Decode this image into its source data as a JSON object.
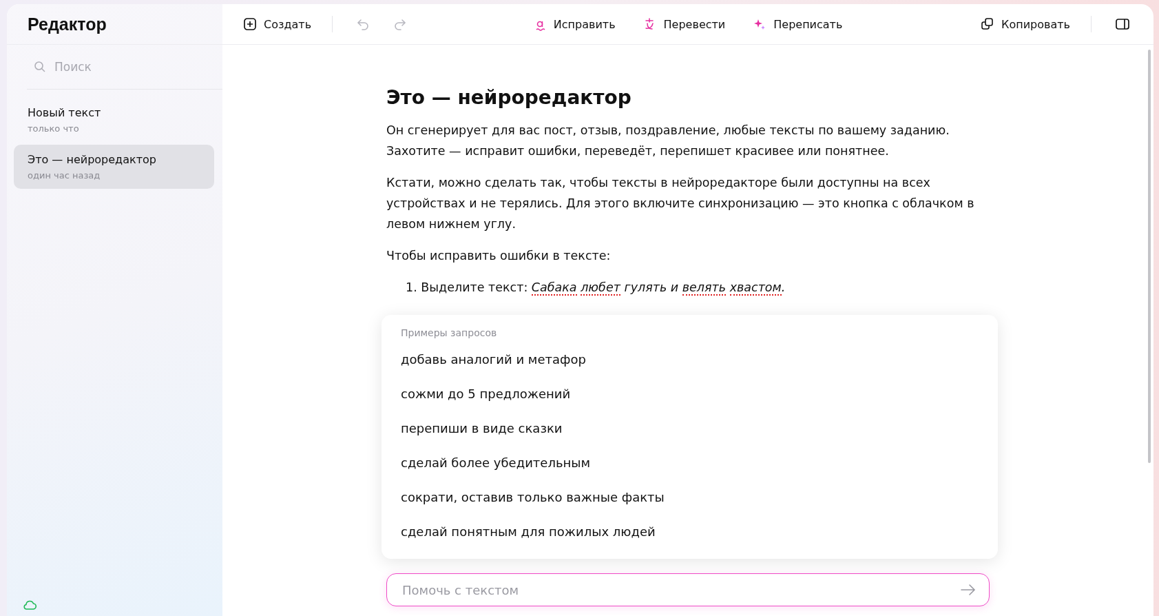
{
  "sidebar": {
    "title": "Редактор",
    "search": {
      "placeholder": "Поиск"
    },
    "items": [
      {
        "title": "Новый текст",
        "time": "только что",
        "selected": false
      },
      {
        "title": "Это — нейроредактор",
        "time": "один час назад",
        "selected": true
      }
    ]
  },
  "toolbar": {
    "create": "Создать",
    "undo_disabled": true,
    "redo_disabled": true,
    "actions": [
      {
        "kind": "fix",
        "label": "Исправить"
      },
      {
        "kind": "translate",
        "label": "Перевести"
      },
      {
        "kind": "rewrite",
        "label": "Переписать"
      }
    ],
    "copy": "Копировать"
  },
  "document": {
    "title": "Это — нейроредактор",
    "paragraphs": [
      "Он сгенерирует для вас пост, отзыв, поздравление, любые тексты по вашему заданию. Захотите — исправит ошибки, переведёт, перепишет красивее или понятнее.",
      "Кстати, можно сделать так, чтобы тексты в нейроредакторе были доступны на всех устройствах и не терялись. Для этого включите синхронизацию — это кнопка с облачком в левом нижнем углу.",
      "Чтобы исправить ошибки в тексте:"
    ],
    "list_item": {
      "number": "1.",
      "prefix": "Выделите текст:",
      "example": [
        {
          "text": "Сабака",
          "misspelled": true
        },
        {
          "text": "любет",
          "misspelled": true
        },
        {
          "text": "гулять",
          "misspelled": false
        },
        {
          "text": "и",
          "misspelled": false
        },
        {
          "text": "велять",
          "misspelled": true
        },
        {
          "text": "хвастом",
          "misspelled": true
        }
      ],
      "suffix": "."
    }
  },
  "suggestions": {
    "heading": "Примеры запросов",
    "items": [
      "добавь аналогий и метафор",
      "сожми до 5 предложений",
      "перепиши в виде сказки",
      "сделай более убедительным",
      "сократи, оставив только важные факты",
      "сделай понятным для пожилых людей"
    ]
  },
  "prompt": {
    "placeholder": "Помочь с текстом"
  }
}
